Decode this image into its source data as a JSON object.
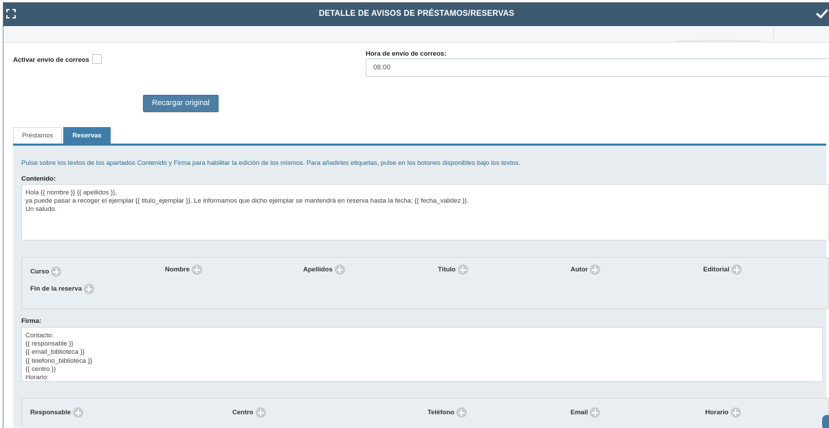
{
  "window": {
    "title": "DETALLE DE AVISOS DE PRÉSTAMOS/RESERVAS"
  },
  "settings": {
    "activar_label": "Activar envío de correos",
    "activar_checked": false,
    "hora_label": "Hora de envío de correos:",
    "hora_value": "08:00",
    "recargar_label": "Recargar original"
  },
  "tabs": [
    {
      "label": "Préstamos",
      "active": false
    },
    {
      "label": "Reservas",
      "active": true
    }
  ],
  "panel": {
    "info": "Pulse sobre los textos de los apartados Contenido y Firma para habilitar la edición de los mismos. Para añadirles etiquetas, pulse en los botones disponibles bajo los textos.",
    "contenido_label": "Contenido:",
    "contenido_lines": [
      "Hola {{ nombre }} {{ apellidos }},",
      "ya puede pasar a recoger el ejemplar {{ titulo_ejemplar }}. Le informamos que dicho ejemplar se mantendrá en reserva hasta la fecha: {{ fecha_validez }}.",
      "Un saludo."
    ],
    "contenido_tags": [
      "Curso",
      "Nombre",
      "Apellidos",
      "Título",
      "Autor",
      "Editorial",
      "Fin de la reserva"
    ],
    "firma_label": "Firma:",
    "firma_lines": [
      "Contacto:",
      "{{ responsable }}",
      "{{ email_biblioteca }}",
      "{{ telefono_biblioteca }}",
      "{{ centro }}",
      "Horario:"
    ],
    "firma_tags": [
      "Responsable",
      "Centro",
      "Teléfono",
      "Email",
      "Horario"
    ]
  },
  "colors": {
    "titlebar": "#3e5a70",
    "accent": "#3e7ea8",
    "button": "#4d7fa6",
    "panel": "#e6ecf0"
  },
  "icons": [
    "expand-icon",
    "check-icon",
    "plus-circle-icon"
  ]
}
